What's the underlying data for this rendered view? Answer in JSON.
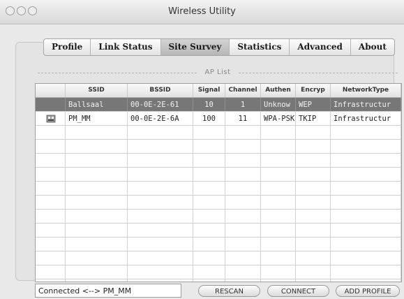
{
  "window": {
    "title": "Wireless Utility"
  },
  "tabs": [
    {
      "label": "Profile",
      "active": false
    },
    {
      "label": "Link Status",
      "active": false
    },
    {
      "label": "Site Survey",
      "active": true
    },
    {
      "label": "Statistics",
      "active": false
    },
    {
      "label": "Advanced",
      "active": false
    },
    {
      "label": "About",
      "active": false
    }
  ],
  "ap_list": {
    "title": "AP List",
    "columns": [
      "",
      "SSID",
      "BSSID",
      "Signal",
      "Channel",
      "Authen",
      "Encryp",
      "NetworkType"
    ],
    "rows": [
      {
        "icon": "",
        "ssid": "Ballsaal",
        "bssid": "00-0E-2E-61",
        "signal": "10",
        "channel": "1",
        "authen": "Unknow",
        "encryp": "WEP",
        "network_type": "Infrastructur",
        "selected": true
      },
      {
        "icon": "access-point-icon",
        "ssid": "PM_MM",
        "bssid": "00-0E-2E-6A",
        "signal": "100",
        "channel": "11",
        "authen": "WPA-PSK",
        "encryp": "TKIP",
        "network_type": "Infrastructur",
        "selected": false
      }
    ]
  },
  "status": {
    "text": "Connected <--> PM_MM"
  },
  "buttons": {
    "rescan": "RESCAN",
    "connect": "CONNECT",
    "add_profile": "ADD PROFILE"
  },
  "colors": {
    "selected_row": "#777777",
    "window_bg": "#e9e9e9"
  }
}
